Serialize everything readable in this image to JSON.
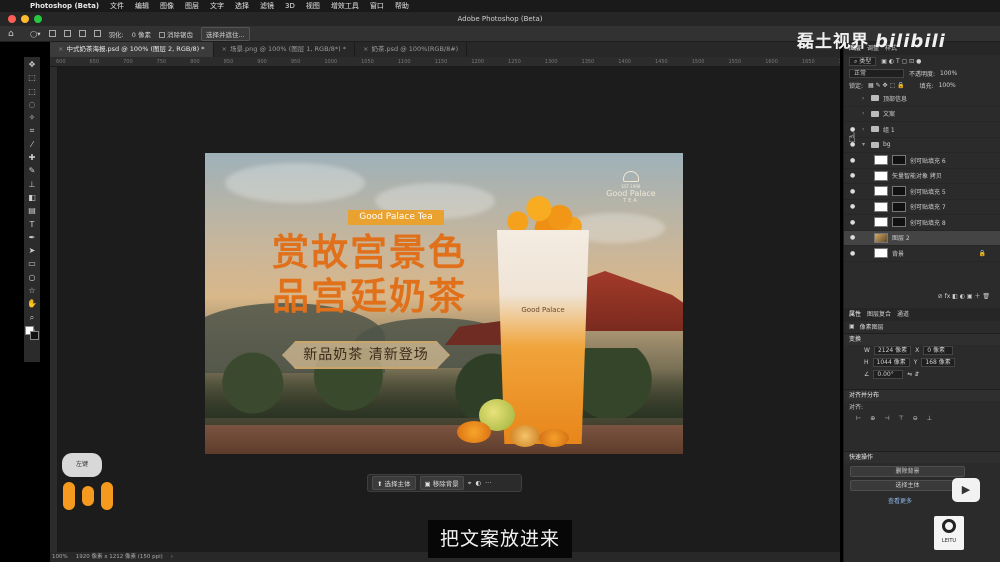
{
  "menubar": {
    "app_name": "Photoshop (Beta)",
    "items": [
      "文件",
      "编辑",
      "图像",
      "图层",
      "文字",
      "选择",
      "滤镜",
      "3D",
      "视图",
      "增效工具",
      "窗口",
      "帮助"
    ]
  },
  "titlebar": {
    "title": "Adobe Photoshop (Beta)"
  },
  "options_bar": {
    "feather_label": "羽化:",
    "feather_value": "0 像素",
    "antialias_label": "消除锯齿",
    "select_mask_button": "选择并遮住..."
  },
  "doc_tabs": [
    {
      "label": "中式奶茶海报.psd @ 100% (图层 2, RGB/8) *",
      "active": true
    },
    {
      "label": "场景.png @ 100% (图层 1, RGB/8*) *",
      "active": false
    },
    {
      "label": "奶茶.psd @ 100%(RGB/8#)",
      "active": false
    }
  ],
  "ruler_ticks": [
    "600",
    "650",
    "700",
    "750",
    "800",
    "850",
    "900",
    "950",
    "1000",
    "1050",
    "1100",
    "1150",
    "1200",
    "1250",
    "1300",
    "1350",
    "1400",
    "1450",
    "1500",
    "1550",
    "1600",
    "1650",
    "1700",
    "1750",
    "1800"
  ],
  "artwork": {
    "badge": "Good Palace Tea",
    "headline_line1": "赏故宫景色",
    "headline_line2": "品宫廷奶茶",
    "ribbon": "新品奶茶 清新登场",
    "brand_est": "EST 1998",
    "brand_name": "Good Palace",
    "brand_tea": "TEA",
    "cup_label": "Good Palace"
  },
  "contextual_taskbar": {
    "select_subject": "选择主体",
    "remove_background": "移除背景",
    "more": "···"
  },
  "status_bar": {
    "zoom": "100%",
    "doc_info": "1920 像素 x 1212 像素 (150 ppi)"
  },
  "overlay": {
    "left_click_label": "左键",
    "subtitle": "把文案放进来",
    "watermark": "磊土视界",
    "bilibili": "bilibili",
    "leitu_label": "LEITU"
  },
  "layers_panel": {
    "tabs": [
      "图层",
      "调整",
      "样式"
    ],
    "filter_label": "类型",
    "blend_mode": "正常",
    "opacity_label": "不透明度:",
    "opacity_value": "100%",
    "lock_label": "锁定:",
    "fill_label": "填充:",
    "fill_value": "100%",
    "layers": [
      {
        "name": "顶部信息",
        "kind": "group",
        "visible": false
      },
      {
        "name": "文案",
        "kind": "group",
        "visible": false
      },
      {
        "name": "组 1",
        "kind": "group",
        "visible": true
      },
      {
        "name": "bg",
        "kind": "group-open",
        "visible": true
      },
      {
        "name": "创可贴填充 6",
        "kind": "adjust",
        "visible": true
      },
      {
        "name": "矢量智能对象 拷贝",
        "kind": "smart",
        "visible": true
      },
      {
        "name": "创可贴填充 5",
        "kind": "adjust",
        "visible": true
      },
      {
        "name": "创可贴填充 7",
        "kind": "adjust",
        "visible": true
      },
      {
        "name": "创可贴填充 8",
        "kind": "adjust",
        "visible": true
      },
      {
        "name": "图层 2",
        "kind": "photo",
        "visible": true,
        "selected": true
      },
      {
        "name": "背景",
        "kind": "background",
        "visible": true
      }
    ]
  },
  "properties_panel": {
    "tabs": [
      "属性",
      "图层复合",
      "通道"
    ],
    "type_label": "像素图层",
    "transform_title": "变换",
    "w_label": "W",
    "w_value": "2124 像素",
    "x_label": "X",
    "x_value": "0 像素",
    "h_label": "H",
    "h_value": "1044 像素",
    "y_label": "Y",
    "y_value": "168 像素",
    "angle_value": "0.00°",
    "align_title": "对齐并分布",
    "align_label": "对齐:",
    "quick_actions_title": "快速操作",
    "remove_bg_button": "删除背景",
    "select_subject_button": "选择主体",
    "view_more": "查看更多"
  }
}
